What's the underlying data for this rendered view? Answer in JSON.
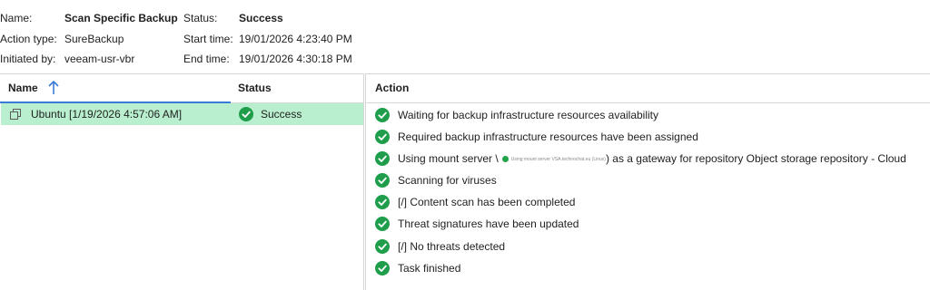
{
  "summary": {
    "name_label": "Name:",
    "name_value": "Scan Specific Backup",
    "action_type_label": "Action type:",
    "action_type_value": "SureBackup",
    "initiated_by_label": "Initiated by:",
    "initiated_by_value": "veeam-usr-vbr",
    "status_label": "Status:",
    "status_value": "Success",
    "start_time_label": "Start time:",
    "start_time_value": "19/01/2026 4:23:40 PM",
    "end_time_label": "End time:",
    "end_time_value": "19/01/2026 4:30:18 PM"
  },
  "sessions_table": {
    "columns": {
      "name": "Name",
      "status": "Status"
    },
    "rows": [
      {
        "name": "Ubuntu [1/19/2026 4:57:06 AM]",
        "status": "Success",
        "icon": "vm-icon"
      }
    ]
  },
  "action_panel": {
    "header": "Action",
    "items": [
      {
        "text": "Waiting for backup infrastructure resources availability"
      },
      {
        "text": "Required backup infrastructure resources have been assigned"
      },
      {
        "text_before": "Using mount server \\",
        "blurred": "Using mount server VSA.technochat.eu (Linux)",
        "text_after": ") as a gateway for repository Object storage repository - Cloud"
      },
      {
        "text": "Scanning for viruses"
      },
      {
        "text": "[/] Content scan has been completed"
      },
      {
        "text": "Threat signatures have been updated"
      },
      {
        "text": "[/] No threats detected"
      },
      {
        "text": "Task finished"
      }
    ]
  },
  "colors": {
    "selected_row": "#b9efcf",
    "success_green": "#1e9e4a",
    "sort_arrow": "#3a7bd5"
  }
}
